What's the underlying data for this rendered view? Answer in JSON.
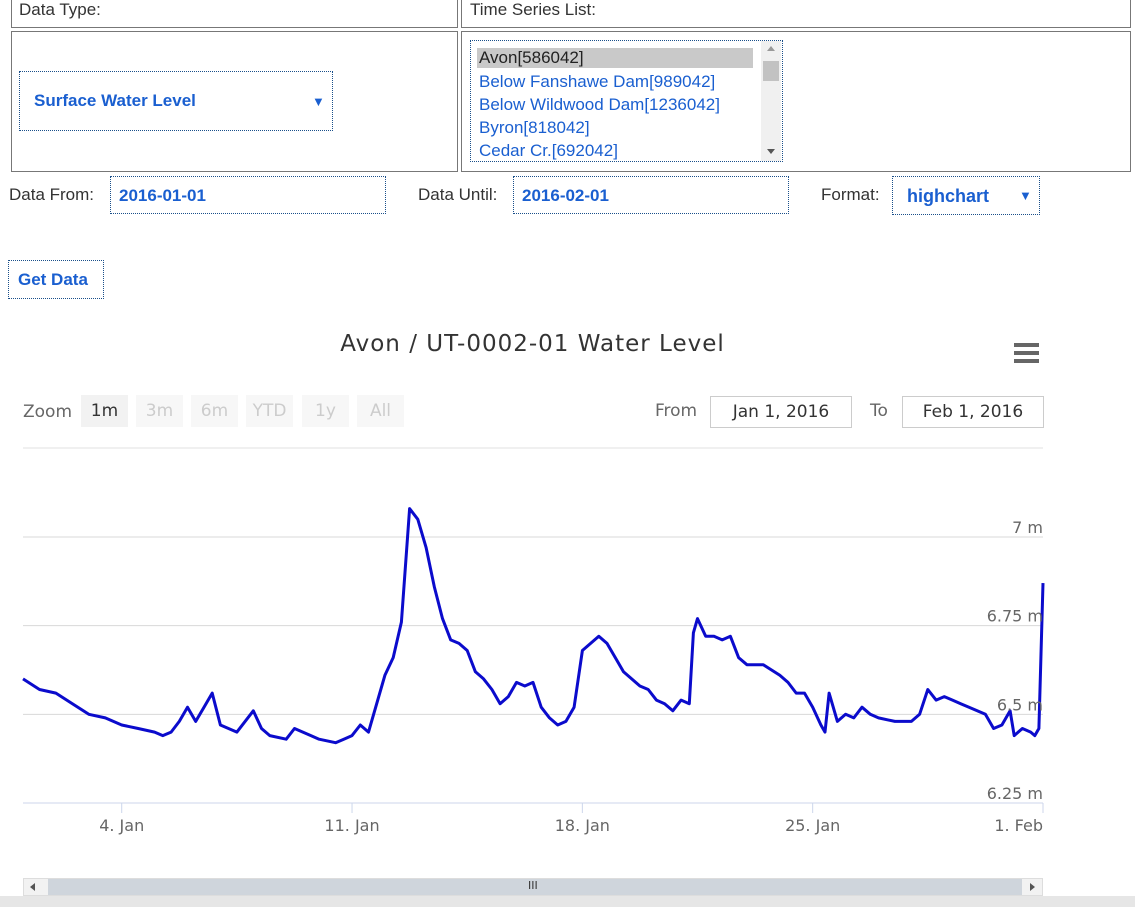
{
  "form": {
    "data_type_label": "Data Type:",
    "data_type_value": "Surface Water Level",
    "series_list_label": "Time Series List:",
    "series_items": [
      "Avon[586042]",
      "Below Fanshawe Dam[989042]",
      "Below Wildwood Dam[1236042]",
      "Byron[818042]",
      "Cedar Cr.[692042]"
    ],
    "data_from_label": "Data From:",
    "data_from_value": "2016-01-01",
    "data_until_label": "Data Until:",
    "data_until_value": "2016-02-01",
    "format_label": "Format:",
    "format_value": "highchart",
    "get_data_label": "Get Data",
    "caret": "▼"
  },
  "chart": {
    "zoom_label": "Zoom",
    "zoom_buttons": [
      "1m",
      "3m",
      "6m",
      "YTD",
      "1y",
      "All"
    ],
    "from_label": "From",
    "from_value": "Jan 1, 2016",
    "to_label": "To",
    "to_value": "Feb 1, 2016",
    "menu_icon": "hamburger-menu-icon",
    "navigator_handle": "III"
  },
  "colors": {
    "series": "#0b0bcc",
    "link": "#1a5fd0",
    "grid": "#d8d8d8"
  },
  "chart_data": {
    "type": "line",
    "title": "Avon / UT-0002-01 Water Level",
    "y_unit": "m",
    "y_ticks": [
      "6.25 m",
      "6.5 m",
      "6.75 m",
      "7 m"
    ],
    "y_tick_values": [
      6.25,
      6.5,
      6.75,
      7.0
    ],
    "ylim": [
      6.25,
      7.0
    ],
    "x_ticks": [
      "4. Jan",
      "11. Jan",
      "18. Jan",
      "25. Jan",
      "1. Feb"
    ],
    "x_tick_values": [
      "2016-01-04",
      "2016-01-11",
      "2016-01-18",
      "2016-01-25",
      "2016-02-01"
    ],
    "xlim": [
      "2016-01-01",
      "2016-02-01"
    ],
    "grid": true,
    "series": [
      {
        "values": [
          [
            "2016-01-01",
            6.6
          ],
          [
            "2016-01-01T12",
            6.57
          ],
          [
            "2016-01-02",
            6.56
          ],
          [
            "2016-01-02T12",
            6.53
          ],
          [
            "2016-01-03",
            6.5
          ],
          [
            "2016-01-03T12",
            6.49
          ],
          [
            "2016-01-04",
            6.47
          ],
          [
            "2016-01-04T12",
            6.46
          ],
          [
            "2016-01-05",
            6.45
          ],
          [
            "2016-01-05T06",
            6.44
          ],
          [
            "2016-01-05T12",
            6.45
          ],
          [
            "2016-01-05T18",
            6.48
          ],
          [
            "2016-01-06",
            6.52
          ],
          [
            "2016-01-06T06",
            6.48
          ],
          [
            "2016-01-06T12",
            6.52
          ],
          [
            "2016-01-06T18",
            6.56
          ],
          [
            "2016-01-07",
            6.47
          ],
          [
            "2016-01-07T12",
            6.45
          ],
          [
            "2016-01-08",
            6.51
          ],
          [
            "2016-01-08T06",
            6.46
          ],
          [
            "2016-01-08T12",
            6.44
          ],
          [
            "2016-01-09",
            6.43
          ],
          [
            "2016-01-09T06",
            6.46
          ],
          [
            "2016-01-09T18",
            6.44
          ],
          [
            "2016-01-10",
            6.43
          ],
          [
            "2016-01-10T12",
            6.42
          ],
          [
            "2016-01-10T18",
            6.43
          ],
          [
            "2016-01-11",
            6.44
          ],
          [
            "2016-01-11T06",
            6.47
          ],
          [
            "2016-01-11T12",
            6.45
          ],
          [
            "2016-01-11T18",
            6.53
          ],
          [
            "2016-01-12",
            6.61
          ],
          [
            "2016-01-12T06",
            6.66
          ],
          [
            "2016-01-12T12",
            6.76
          ],
          [
            "2016-01-12T18",
            7.08
          ],
          [
            "2016-01-13",
            7.05
          ],
          [
            "2016-01-13T06",
            6.97
          ],
          [
            "2016-01-13T12",
            6.86
          ],
          [
            "2016-01-13T18",
            6.77
          ],
          [
            "2016-01-14",
            6.71
          ],
          [
            "2016-01-14T06",
            6.7
          ],
          [
            "2016-01-14T12",
            6.68
          ],
          [
            "2016-01-14T18",
            6.62
          ],
          [
            "2016-01-15",
            6.6
          ],
          [
            "2016-01-15T06",
            6.57
          ],
          [
            "2016-01-15T12",
            6.53
          ],
          [
            "2016-01-15T18",
            6.55
          ],
          [
            "2016-01-16",
            6.59
          ],
          [
            "2016-01-16T06",
            6.58
          ],
          [
            "2016-01-16T12",
            6.59
          ],
          [
            "2016-01-16T18",
            6.52
          ],
          [
            "2016-01-17",
            6.49
          ],
          [
            "2016-01-17T06",
            6.47
          ],
          [
            "2016-01-17T12",
            6.48
          ],
          [
            "2016-01-17T18",
            6.52
          ],
          [
            "2016-01-18",
            6.68
          ],
          [
            "2016-01-18T06",
            6.7
          ],
          [
            "2016-01-18T12",
            6.72
          ],
          [
            "2016-01-18T18",
            6.7
          ],
          [
            "2016-01-19",
            6.66
          ],
          [
            "2016-01-19T06",
            6.62
          ],
          [
            "2016-01-19T12",
            6.6
          ],
          [
            "2016-01-19T18",
            6.58
          ],
          [
            "2016-01-20",
            6.57
          ],
          [
            "2016-01-20T06",
            6.54
          ],
          [
            "2016-01-20T12",
            6.53
          ],
          [
            "2016-01-20T18",
            6.51
          ],
          [
            "2016-01-21",
            6.54
          ],
          [
            "2016-01-21T06",
            6.53
          ],
          [
            "2016-01-21T09",
            6.73
          ],
          [
            "2016-01-21T12",
            6.77
          ],
          [
            "2016-01-21T18",
            6.72
          ],
          [
            "2016-01-22",
            6.72
          ],
          [
            "2016-01-22T06",
            6.71
          ],
          [
            "2016-01-22T12",
            6.72
          ],
          [
            "2016-01-22T18",
            6.66
          ],
          [
            "2016-01-23",
            6.64
          ],
          [
            "2016-01-23T12",
            6.64
          ],
          [
            "2016-01-24",
            6.61
          ],
          [
            "2016-01-24T06",
            6.59
          ],
          [
            "2016-01-24T12",
            6.56
          ],
          [
            "2016-01-24T18",
            6.56
          ],
          [
            "2016-01-25",
            6.52
          ],
          [
            "2016-01-25T06",
            6.47
          ],
          [
            "2016-01-25T09",
            6.45
          ],
          [
            "2016-01-25T12",
            6.56
          ],
          [
            "2016-01-25T18",
            6.48
          ],
          [
            "2016-01-26",
            6.5
          ],
          [
            "2016-01-26T06",
            6.49
          ],
          [
            "2016-01-26T12",
            6.52
          ],
          [
            "2016-01-26T18",
            6.5
          ],
          [
            "2016-01-27",
            6.49
          ],
          [
            "2016-01-27T12",
            6.48
          ],
          [
            "2016-01-28",
            6.48
          ],
          [
            "2016-01-28T06",
            6.5
          ],
          [
            "2016-01-28T12",
            6.57
          ],
          [
            "2016-01-28T18",
            6.54
          ],
          [
            "2016-01-29",
            6.55
          ],
          [
            "2016-01-29T06",
            6.54
          ],
          [
            "2016-01-29T12",
            6.53
          ],
          [
            "2016-01-29T18",
            6.52
          ],
          [
            "2016-01-30",
            6.51
          ],
          [
            "2016-01-30T06",
            6.5
          ],
          [
            "2016-01-30T12",
            6.46
          ],
          [
            "2016-01-30T18",
            6.47
          ],
          [
            "2016-01-31",
            6.51
          ],
          [
            "2016-01-31T03",
            6.44
          ],
          [
            "2016-01-31T09",
            6.46
          ],
          [
            "2016-01-31T15",
            6.45
          ],
          [
            "2016-01-31T18",
            6.44
          ],
          [
            "2016-01-31T21",
            6.46
          ],
          [
            "2016-02-01",
            6.87
          ]
        ]
      }
    ]
  }
}
